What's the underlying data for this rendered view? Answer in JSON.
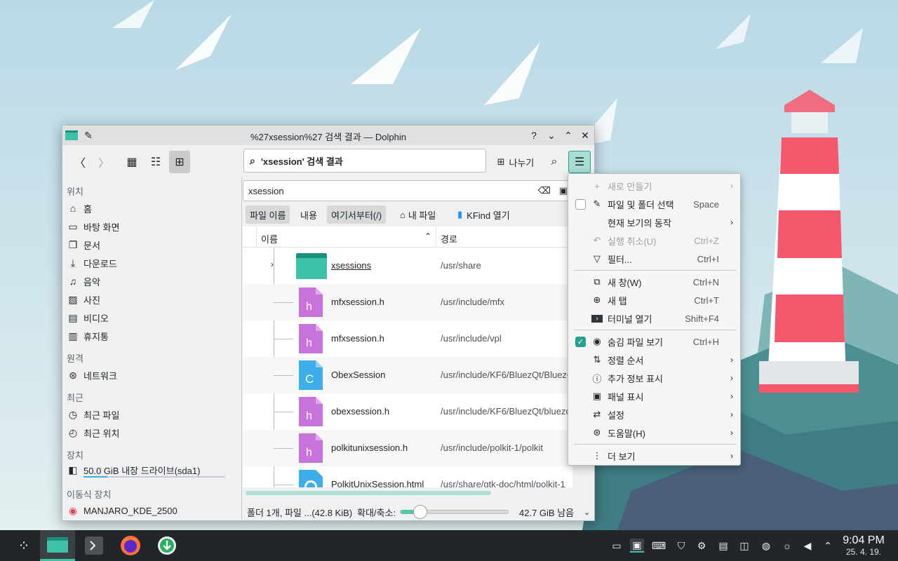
{
  "window": {
    "title": "%27xsession%27 검색 결과 — Dolphin",
    "location_text": "'xsession' 검색 결과",
    "share_label": "나누기"
  },
  "sidebar": {
    "places_heading": "위치",
    "places": [
      {
        "label": "홈",
        "icon": "home-icon"
      },
      {
        "label": "바탕 화면",
        "icon": "desktop-icon"
      },
      {
        "label": "문서",
        "icon": "documents-icon"
      },
      {
        "label": "다운로드",
        "icon": "download-icon"
      },
      {
        "label": "음악",
        "icon": "music-icon"
      },
      {
        "label": "사진",
        "icon": "pictures-icon"
      },
      {
        "label": "비디오",
        "icon": "video-icon"
      },
      {
        "label": "휴지통",
        "icon": "trash-icon"
      }
    ],
    "remote_heading": "원격",
    "remote": [
      {
        "label": "네트워크",
        "icon": "network-icon"
      }
    ],
    "recent_heading": "최근",
    "recent": [
      {
        "label": "최근 파일",
        "icon": "recent-files-icon"
      },
      {
        "label": "최근 위치",
        "icon": "recent-locations-icon"
      }
    ],
    "devices_heading": "장치",
    "devices": [
      {
        "label": "50.0 GiB 내장 드라이브(sda1)",
        "icon": "drive-icon",
        "used_fraction": 0.17
      }
    ],
    "removable_heading": "이동식 장치",
    "removable": [
      {
        "label": "MANJARO_KDE_2500",
        "icon": "optical-disc-icon"
      }
    ]
  },
  "search": {
    "query": "xsession",
    "filters": [
      {
        "label": "파일 이름",
        "active": true
      },
      {
        "label": "내용",
        "active": false
      },
      {
        "label": "여기서부터(/)",
        "active": true
      },
      {
        "label": "내 파일",
        "active": false,
        "icon": "home-icon"
      },
      {
        "label": "KFind 열기",
        "active": false,
        "icon": "kfind-icon"
      }
    ]
  },
  "columns": {
    "name": "이름",
    "path": "경로"
  },
  "files": [
    {
      "name": "xsessions",
      "path": "/usr/share",
      "type": "folder"
    },
    {
      "name": "mfxsession.h",
      "path": "/usr/include/mfx",
      "type": "h"
    },
    {
      "name": "mfxsession.h",
      "path": "/usr/include/vpl",
      "type": "h"
    },
    {
      "name": "ObexSession",
      "path": "/usr/include/KF6/BluezQt/BluezQt",
      "type": "c"
    },
    {
      "name": "obexsession.h",
      "path": "/usr/include/KF6/BluezQt/bluezqt",
      "type": "h"
    },
    {
      "name": "polkitunixsession.h",
      "path": "/usr/include/polkit-1/polkit",
      "type": "h"
    },
    {
      "name": "PolkitUnixSession.html",
      "path": "/usr/share/gtk-doc/html/polkit-1",
      "type": "html"
    }
  ],
  "statusbar": {
    "summary": "폴더 1개, 파일 ...(42.8 KiB)",
    "zoom_label": "확대/축소:",
    "zoom_fraction": 0.18,
    "free_space": "42.7 GiB 남음"
  },
  "menu": {
    "items": [
      {
        "label": "새로 만들기",
        "icon": "plus-icon",
        "disabled": true,
        "submenu": true
      },
      {
        "label": "파일 및 폴더 선택",
        "icon": "select-icon",
        "shortcut": "Space",
        "checkbox": false
      },
      {
        "label": "현재 보기의 동작",
        "submenu": true
      },
      {
        "label": "실행 취소(U)",
        "icon": "undo-icon",
        "shortcut": "Ctrl+Z",
        "disabled": true
      },
      {
        "label": "필터...",
        "icon": "filter-icon",
        "shortcut": "Ctrl+I"
      },
      {
        "label": "새 창(W)",
        "icon": "new-window-icon",
        "shortcut": "Ctrl+N"
      },
      {
        "label": "새 탭",
        "icon": "new-tab-icon",
        "shortcut": "Ctrl+T"
      },
      {
        "label": "터미널 열기",
        "icon": "terminal-icon",
        "shortcut": "Shift+F4"
      },
      {
        "label": "숨김 파일 보기",
        "icon": "eye-icon",
        "shortcut": "Ctrl+H",
        "checkbox": true
      },
      {
        "label": "정렬 순서",
        "icon": "sort-icon",
        "submenu": true
      },
      {
        "label": "추가 정보 표시",
        "icon": "info-icon",
        "submenu": true
      },
      {
        "label": "패널 표시",
        "icon": "panel-icon",
        "submenu": true
      },
      {
        "label": "설정",
        "icon": "settings-icon",
        "submenu": true
      },
      {
        "label": "도움말(H)",
        "icon": "help-icon",
        "submenu": true
      },
      {
        "label": "더 보기",
        "icon": "more-icon",
        "submenu": true
      }
    ]
  },
  "taskbar": {
    "time": "9:04 PM",
    "date": "25. 4. 19."
  },
  "colors": {
    "accent": "#2aa18e",
    "folder": "#3ec1a6",
    "header_file": "#c873da",
    "c_file": "#3daee9",
    "taskbar": "#232629"
  }
}
